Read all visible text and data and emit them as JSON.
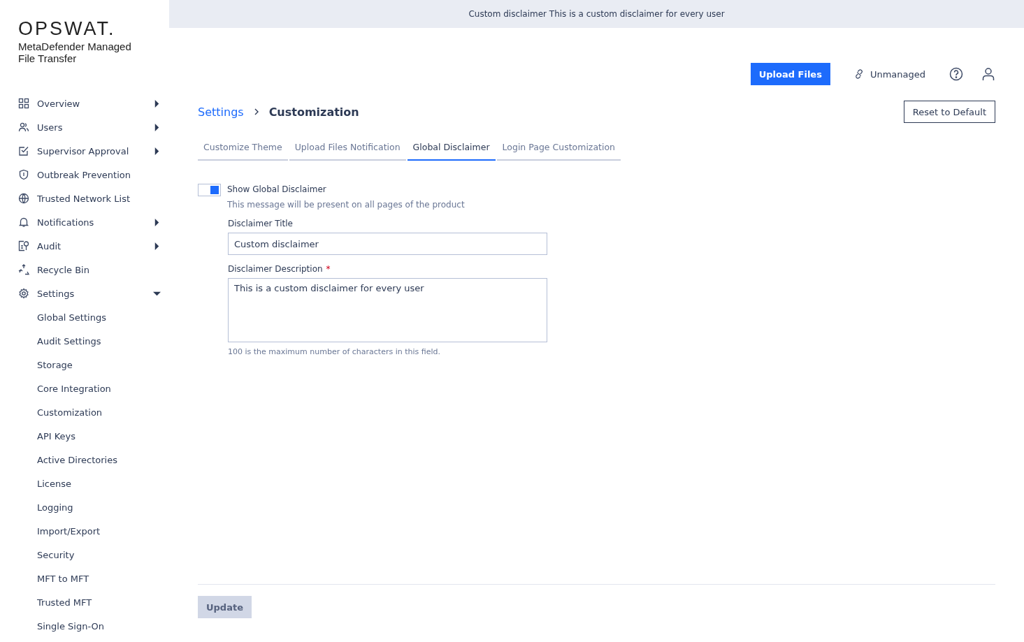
{
  "brand": {
    "logo": "OPSWAT.",
    "product": "MetaDefender Managed File Transfer"
  },
  "sidebar": {
    "items": [
      {
        "label": "Overview",
        "expanded": false
      },
      {
        "label": "Users",
        "expanded": false
      },
      {
        "label": "Supervisor Approval",
        "expanded": false
      },
      {
        "label": "Outbreak Prevention"
      },
      {
        "label": "Trusted Network List"
      },
      {
        "label": "Notifications",
        "expanded": false
      },
      {
        "label": "Audit",
        "expanded": false
      },
      {
        "label": "Recycle Bin"
      },
      {
        "label": "Settings",
        "expanded": true,
        "children": [
          {
            "label": "Global Settings"
          },
          {
            "label": "Audit Settings"
          },
          {
            "label": "Storage"
          },
          {
            "label": "Core Integration"
          },
          {
            "label": "Customization"
          },
          {
            "label": "API Keys"
          },
          {
            "label": "Active Directories"
          },
          {
            "label": "License"
          },
          {
            "label": "Logging"
          },
          {
            "label": "Import/Export"
          },
          {
            "label": "Security"
          },
          {
            "label": "MFT to MFT"
          },
          {
            "label": "Trusted MFT"
          },
          {
            "label": "Single Sign-On"
          }
        ]
      }
    ]
  },
  "banner": {
    "title": "Custom disclaimer",
    "text": "This is a custom disclaimer for every user"
  },
  "header": {
    "upload_button": "Upload Files",
    "status": "Unmanaged"
  },
  "breadcrumb": [
    "Settings",
    "Customization"
  ],
  "reset_button": "Reset to Default",
  "tabs": [
    {
      "label": "Customize Theme",
      "selected": false
    },
    {
      "label": "Upload Files Notification",
      "selected": false
    },
    {
      "label": "Global Disclaimer",
      "selected": true
    },
    {
      "label": "Login Page Customization",
      "selected": false
    }
  ],
  "form": {
    "toggle": {
      "label": "Show Global Disclaimer",
      "on": true,
      "hint": "This message will be present on all pages of the product"
    },
    "title_field": {
      "label": "Disclaimer Title",
      "value": "Custom disclaimer"
    },
    "description_field": {
      "label": "Disclaimer Description",
      "required": true,
      "required_mark": "*",
      "value": "This is a custom disclaimer for every user",
      "hint": "100 is the maximum number of characters in this field."
    }
  },
  "update_button": {
    "label": "Update",
    "disabled": true
  }
}
